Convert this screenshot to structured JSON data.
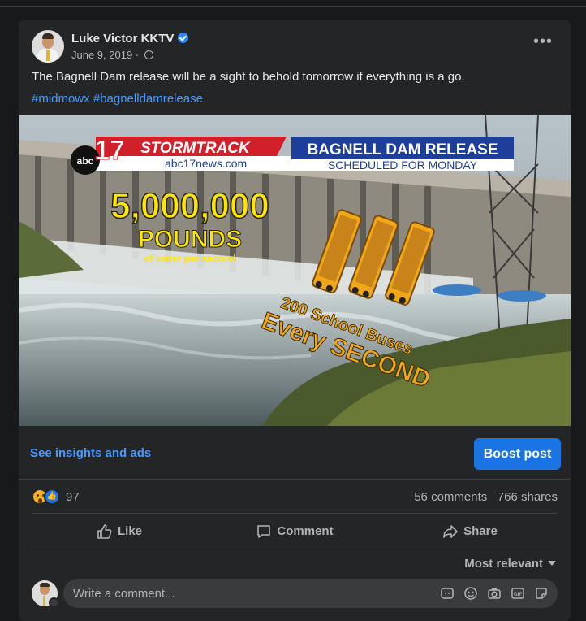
{
  "post": {
    "author": "Luke Victor KKTV",
    "date": "June 9, 2019",
    "date_sep": " · ",
    "caption": "The Bagnell Dam release will be a sight to behold tomorrow if everything is a go.",
    "hashtags": "#midmowx #bagnelldamrelease"
  },
  "media": {
    "channel_number": "17",
    "network_logo": "abc",
    "brand": "STORMTRACK",
    "website": "abc17news.com",
    "headline": "BAGNELL DAM RELEASE",
    "subheadline": "SCHEDULED FOR MONDAY",
    "big_number": "5,000,000",
    "unit": "POUNDS",
    "unit_sub": "of water per second",
    "buses_line1": "200 School Buses",
    "buses_line2": "Every SECOND"
  },
  "promo": {
    "insights": "See insights and ads",
    "boost": "Boost post"
  },
  "stats": {
    "reactions": "97",
    "comments": "56 comments",
    "shares": "766 shares"
  },
  "actions": {
    "like": "Like",
    "comment": "Comment",
    "share": "Share"
  },
  "sort": {
    "label": "Most relevant"
  },
  "composer": {
    "placeholder": "Write a comment..."
  },
  "colors": {
    "accent": "#1b74e4",
    "link": "#4599ff",
    "banner_red": "#d2202b",
    "banner_blue": "#1d3f9a",
    "graphic_yellow": "#ffe600",
    "graphic_orange": "#f0a818"
  },
  "icons": [
    "verified-icon",
    "globe-icon",
    "more-icon",
    "wow-reaction-icon",
    "like-reaction-icon",
    "like-icon",
    "comment-icon",
    "share-icon",
    "avatar-sticker-icon",
    "emoji-icon",
    "camera-icon",
    "gif-icon",
    "sticker-icon"
  ]
}
